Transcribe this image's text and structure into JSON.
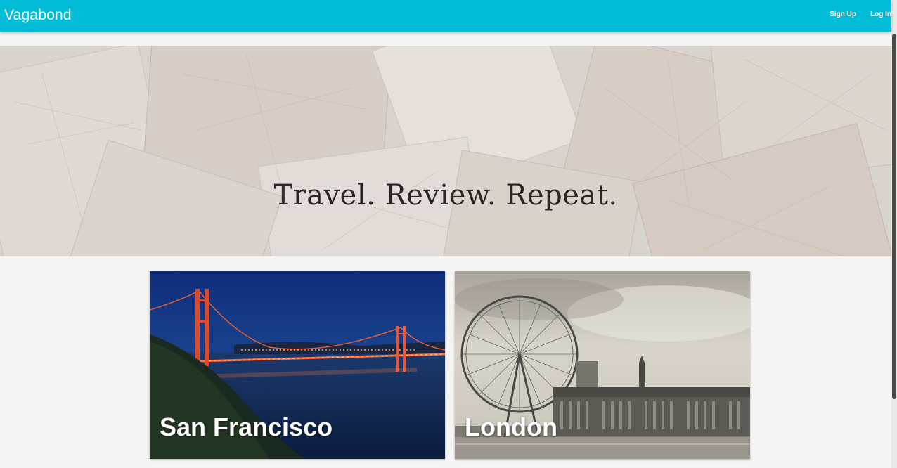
{
  "navbar": {
    "brand": "Vagabond",
    "links": [
      {
        "label": "Sign Up"
      },
      {
        "label": "Log In"
      }
    ],
    "color": "#02bcd7"
  },
  "hero": {
    "tagline": "Travel. Review. Repeat."
  },
  "cities": [
    {
      "name": "San Francisco"
    },
    {
      "name": "London"
    }
  ]
}
